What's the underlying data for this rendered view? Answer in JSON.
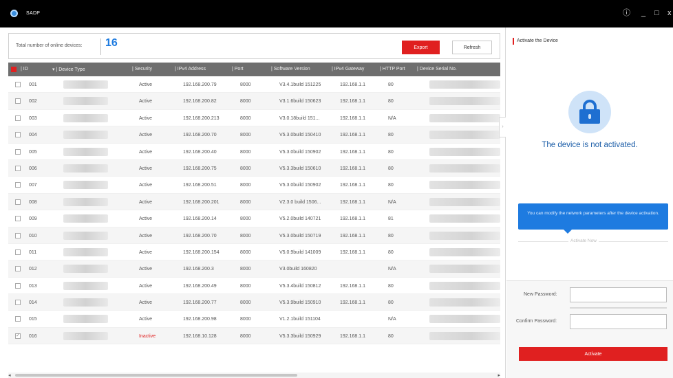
{
  "titlebar": {
    "app_name": "SADP",
    "info_icon": "info-icon",
    "minimize_glyph": "_",
    "maximize_glyph": "□",
    "close_glyph": "x"
  },
  "summary": {
    "label": "Total number of online devices:",
    "count": "16"
  },
  "toolbar": {
    "export_label": "Export",
    "refresh_label": "Refresh"
  },
  "table": {
    "columns": [
      "| ID",
      "▾ | Device Type",
      "| Security",
      "| IPv4 Address",
      "| Port",
      "| Software Version",
      "| IPv4 Gateway",
      "| HTTP Port",
      "| Device Serial No."
    ],
    "rows": [
      {
        "id": "001",
        "security": "Active",
        "ip": "192.168.200.79",
        "port": "8000",
        "version": "V3.4.1build 151225",
        "gateway": "192.168.1.1",
        "http": "80",
        "checked": false
      },
      {
        "id": "002",
        "security": "Active",
        "ip": "192.168.200.82",
        "port": "8000",
        "version": "V3.1.6build 150623",
        "gateway": "192.168.1.1",
        "http": "80",
        "checked": false
      },
      {
        "id": "003",
        "security": "Active",
        "ip": "192.168.200.213",
        "port": "8000",
        "version": "V3.0.18build 151...",
        "gateway": "192.168.1.1",
        "http": "N/A",
        "checked": false
      },
      {
        "id": "004",
        "security": "Active",
        "ip": "192.168.200.70",
        "port": "8000",
        "version": "V5.3.0build 150410",
        "gateway": "192.168.1.1",
        "http": "80",
        "checked": false
      },
      {
        "id": "005",
        "security": "Active",
        "ip": "192.168.200.40",
        "port": "8000",
        "version": "V5.3.0build 150902",
        "gateway": "192.168.1.1",
        "http": "80",
        "checked": false
      },
      {
        "id": "006",
        "security": "Active",
        "ip": "192.168.200.75",
        "port": "8000",
        "version": "V5.3.3build 150610",
        "gateway": "192.168.1.1",
        "http": "80",
        "checked": false
      },
      {
        "id": "007",
        "security": "Active",
        "ip": "192.168.200.51",
        "port": "8000",
        "version": "V5.3.0build 150902",
        "gateway": "192.168.1.1",
        "http": "80",
        "checked": false
      },
      {
        "id": "008",
        "security": "Active",
        "ip": "192.168.200.201",
        "port": "8000",
        "version": "V2.3.0 build 1506...",
        "gateway": "192.168.1.1",
        "http": "N/A",
        "checked": false
      },
      {
        "id": "009",
        "security": "Active",
        "ip": "192.168.200.14",
        "port": "8000",
        "version": "V5.2.0build 140721",
        "gateway": "192.168.1.1",
        "http": "81",
        "checked": false
      },
      {
        "id": "010",
        "security": "Active",
        "ip": "192.168.200.70",
        "port": "8000",
        "version": "V5.3.0build 150719",
        "gateway": "192.168.1.1",
        "http": "80",
        "checked": false
      },
      {
        "id": "011",
        "security": "Active",
        "ip": "192.168.200.154",
        "port": "8000",
        "version": "V5.0.9build 141009",
        "gateway": "192.168.1.1",
        "http": "80",
        "checked": false
      },
      {
        "id": "012",
        "security": "Active",
        "ip": "192.168.200.3",
        "port": "8000",
        "version": "V3.0build 160820",
        "gateway": "",
        "http": "N/A",
        "checked": false
      },
      {
        "id": "013",
        "security": "Active",
        "ip": "192.168.200.49",
        "port": "8000",
        "version": "V5.3.4build 150812",
        "gateway": "192.168.1.1",
        "http": "80",
        "checked": false
      },
      {
        "id": "014",
        "security": "Active",
        "ip": "192.168.200.77",
        "port": "8000",
        "version": "V5.3.9build 150910",
        "gateway": "192.168.1.1",
        "http": "80",
        "checked": false
      },
      {
        "id": "015",
        "security": "Active",
        "ip": "192.168.200.98",
        "port": "8000",
        "version": "V1.2.1build 151104",
        "gateway": "",
        "http": "N/A",
        "checked": false
      },
      {
        "id": "016",
        "security": "Inactive",
        "ip": "192.168.10.128",
        "port": "8000",
        "version": "V5.3.3build 150929",
        "gateway": "192.168.1.1",
        "http": "80",
        "checked": true
      }
    ]
  },
  "activate_panel": {
    "title": "Activate the Device",
    "status": "The device is not activated.",
    "tooltip": "You can modify the network parameters after the device activation.",
    "activate_now": "Activate Now",
    "new_password_label": "New Password:",
    "confirm_password_label": "Confirm Password:",
    "new_password_value": "",
    "confirm_password_value": "",
    "activate_button": "Activate"
  },
  "colors": {
    "accent_red": "#e02020",
    "accent_blue": "#1e7be0",
    "titlebar": "#000000"
  }
}
